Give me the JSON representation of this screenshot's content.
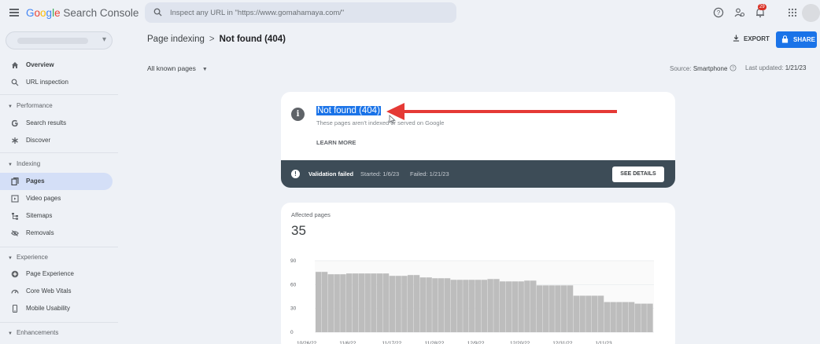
{
  "app": {
    "brand_google": "Google",
    "brand_product": "Search Console",
    "search_placeholder": "Inspect any URL in \"https://www.gomahamaya.com/\"",
    "notification_count": "29"
  },
  "sidebar": {
    "top_items": [
      {
        "label": "Overview",
        "icon": "home-icon"
      },
      {
        "label": "URL inspection",
        "icon": "search-icon"
      }
    ],
    "sections": [
      {
        "title": "Performance",
        "items": [
          {
            "label": "Search results",
            "icon": "google-g-icon"
          },
          {
            "label": "Discover",
            "icon": "asterisk-icon"
          }
        ]
      },
      {
        "title": "Indexing",
        "items": [
          {
            "label": "Pages",
            "icon": "pages-icon",
            "active": true
          },
          {
            "label": "Video pages",
            "icon": "video-page-icon"
          },
          {
            "label": "Sitemaps",
            "icon": "sitemap-icon"
          },
          {
            "label": "Removals",
            "icon": "eye-off-icon"
          }
        ]
      },
      {
        "title": "Experience",
        "items": [
          {
            "label": "Page Experience",
            "icon": "plus-circle-icon"
          },
          {
            "label": "Core Web Vitals",
            "icon": "gauge-icon"
          },
          {
            "label": "Mobile Usability",
            "icon": "phone-icon"
          }
        ]
      },
      {
        "title": "Enhancements",
        "items": []
      }
    ]
  },
  "breadcrumb": {
    "parent": "Page indexing",
    "separator": ">",
    "current": "Not found (404)"
  },
  "actions": {
    "export": "EXPORT",
    "share": "SHARE"
  },
  "filter": {
    "selected": "All known pages"
  },
  "meta": {
    "source_label": "Source:",
    "source_value": "Smartphone",
    "updated_label": "Last updated:",
    "updated_value": "1/21/23"
  },
  "status_card": {
    "title": "Not found (404)",
    "subtitle": "These pages aren't indexed or served on Google",
    "learn_more": "LEARN MORE",
    "validation_status": "Validation failed",
    "started": "Started: 1/6/23",
    "failed": "Failed: 1/21/23",
    "details_button": "SEE DETAILS"
  },
  "chart_card": {
    "label": "Affected pages",
    "value": "35"
  },
  "colors": {
    "accent": "#1a73e8",
    "status_bar": "#3d4c57",
    "bar": "#bdbdbd",
    "annotation_arrow": "#e53935",
    "nav_active": "#d4dff7"
  },
  "chart_data": {
    "type": "bar",
    "ylabel": "",
    "ylim": [
      0,
      90
    ],
    "y_ticks": [
      "90",
      "60",
      "30",
      "0"
    ],
    "x_ticks": [
      "10/26/22",
      "11/6/22",
      "11/17/22",
      "11/28/22",
      "12/9/22",
      "12/20/22",
      "12/31/22",
      "1/11/23"
    ],
    "values": [
      76,
      76,
      73,
      73,
      73,
      74,
      74,
      74,
      74,
      74,
      74,
      74,
      71,
      71,
      71,
      72,
      72,
      69,
      69,
      68,
      68,
      68,
      66,
      66,
      66,
      66,
      66,
      66,
      67,
      67,
      64,
      64,
      64,
      64,
      65,
      65,
      59,
      59,
      59,
      59,
      59,
      59,
      46,
      46,
      46,
      46,
      46,
      38,
      38,
      38,
      38,
      38,
      36,
      36,
      36
    ]
  }
}
